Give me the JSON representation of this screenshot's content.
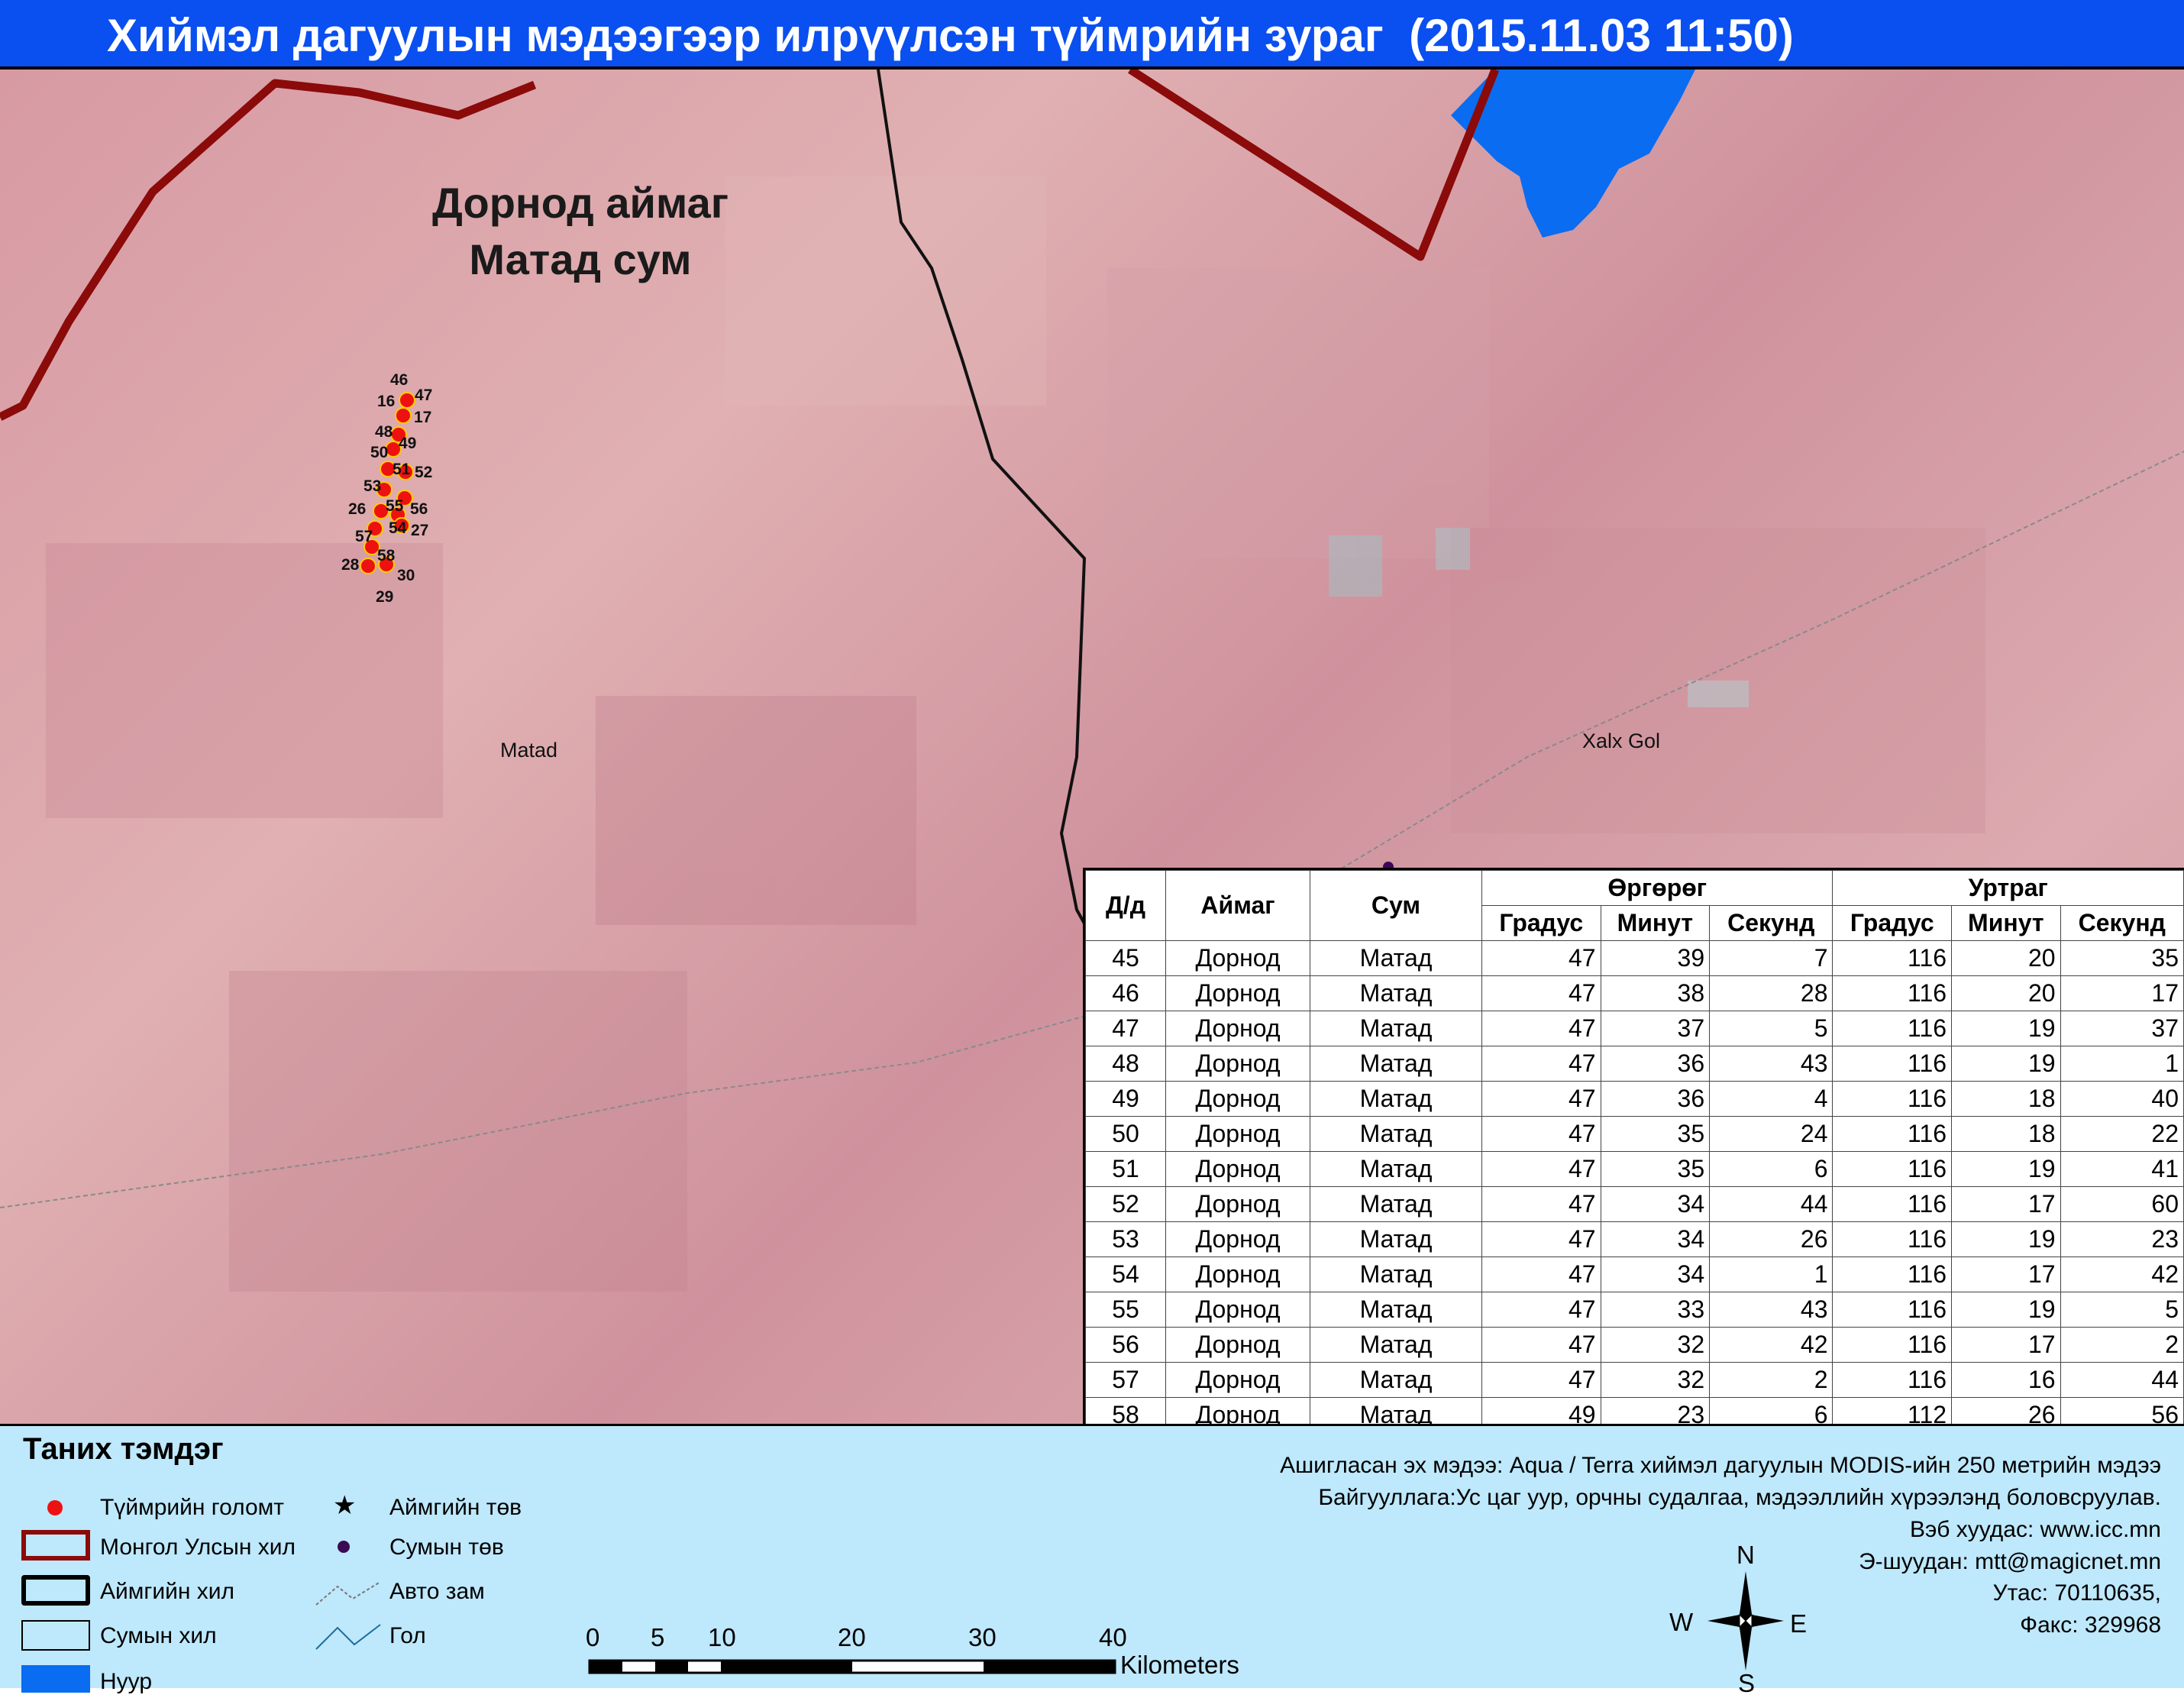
{
  "title": "Хиймэл дагуулын мэдээгээр илрүүлсэн түймрийн зураг  (2015.11.03 11:50)",
  "map": {
    "region_line1": "Дорнод  аймаг",
    "region_line2": "Матад  сум",
    "place_matad": "Matad",
    "place_xalx": "Xalx Gol",
    "fire_labels": [
      "46",
      "47",
      "16",
      "17",
      "48",
      "49",
      "50",
      "51",
      "52",
      "53",
      "26",
      "55",
      "56",
      "57",
      "54",
      "27",
      "28",
      "58",
      "30",
      "29"
    ]
  },
  "table": {
    "headers": {
      "dd": "Д/д",
      "aimag": "Аймаг",
      "sum": "Сум",
      "latitude": "Өргөрөг",
      "longitude": "Уртраг",
      "degree": "Градус",
      "minute": "Минут",
      "second": "Секунд"
    },
    "rows": [
      {
        "dd": "45",
        "aimag": "Дорнод",
        "sum": "Матад",
        "lat_d": "47",
        "lat_m": "39",
        "lat_s": "7",
        "lon_d": "116",
        "lon_m": "20",
        "lon_s": "35"
      },
      {
        "dd": "46",
        "aimag": "Дорнод",
        "sum": "Матад",
        "lat_d": "47",
        "lat_m": "38",
        "lat_s": "28",
        "lon_d": "116",
        "lon_m": "20",
        "lon_s": "17"
      },
      {
        "dd": "47",
        "aimag": "Дорнод",
        "sum": "Матад",
        "lat_d": "47",
        "lat_m": "37",
        "lat_s": "5",
        "lon_d": "116",
        "lon_m": "19",
        "lon_s": "37"
      },
      {
        "dd": "48",
        "aimag": "Дорнод",
        "sum": "Матад",
        "lat_d": "47",
        "lat_m": "36",
        "lat_s": "43",
        "lon_d": "116",
        "lon_m": "19",
        "lon_s": "1"
      },
      {
        "dd": "49",
        "aimag": "Дорнод",
        "sum": "Матад",
        "lat_d": "47",
        "lat_m": "36",
        "lat_s": "4",
        "lon_d": "116",
        "lon_m": "18",
        "lon_s": "40"
      },
      {
        "dd": "50",
        "aimag": "Дорнод",
        "sum": "Матад",
        "lat_d": "47",
        "lat_m": "35",
        "lat_s": "24",
        "lon_d": "116",
        "lon_m": "18",
        "lon_s": "22"
      },
      {
        "dd": "51",
        "aimag": "Дорнод",
        "sum": "Матад",
        "lat_d": "47",
        "lat_m": "35",
        "lat_s": "6",
        "lon_d": "116",
        "lon_m": "19",
        "lon_s": "41"
      },
      {
        "dd": "52",
        "aimag": "Дорнод",
        "sum": "Матад",
        "lat_d": "47",
        "lat_m": "34",
        "lat_s": "44",
        "lon_d": "116",
        "lon_m": "17",
        "lon_s": "60"
      },
      {
        "dd": "53",
        "aimag": "Дорнод",
        "sum": "Матад",
        "lat_d": "47",
        "lat_m": "34",
        "lat_s": "26",
        "lon_d": "116",
        "lon_m": "19",
        "lon_s": "23"
      },
      {
        "dd": "54",
        "aimag": "Дорнод",
        "sum": "Матад",
        "lat_d": "47",
        "lat_m": "34",
        "lat_s": "1",
        "lon_d": "116",
        "lon_m": "17",
        "lon_s": "42"
      },
      {
        "dd": "55",
        "aimag": "Дорнод",
        "sum": "Матад",
        "lat_d": "47",
        "lat_m": "33",
        "lat_s": "43",
        "lon_d": "116",
        "lon_m": "19",
        "lon_s": "5"
      },
      {
        "dd": "56",
        "aimag": "Дорнод",
        "sum": "Матад",
        "lat_d": "47",
        "lat_m": "32",
        "lat_s": "42",
        "lon_d": "116",
        "lon_m": "17",
        "lon_s": "2"
      },
      {
        "dd": "57",
        "aimag": "Дорнод",
        "sum": "Матад",
        "lat_d": "47",
        "lat_m": "32",
        "lat_s": "2",
        "lon_d": "116",
        "lon_m": "16",
        "lon_s": "44"
      },
      {
        "dd": "58",
        "aimag": "Дорнод",
        "sum": "Матад",
        "lat_d": "49",
        "lat_m": "23",
        "lat_s": "6",
        "lon_d": "112",
        "lon_m": "26",
        "lon_s": "56"
      }
    ]
  },
  "legend": {
    "title": "Таних тэмдэг",
    "items": {
      "fire": "Түймрийн голомт",
      "country_border": "Монгол Улсын хил",
      "aimag_border": "Аймгийн хил",
      "sum_border": "Сумын хил",
      "lake": "Нуур",
      "aimag_center": "Аймгийн төв",
      "sum_center": "Сумын төв",
      "road": "Авто зам",
      "river": "Гол"
    },
    "scale": {
      "ticks": [
        "0",
        "5",
        "10",
        "20",
        "30",
        "40"
      ],
      "unit": "Kilometers"
    },
    "compass": {
      "n": "N",
      "s": "S",
      "e": "E",
      "w": "W"
    },
    "info": {
      "source": "Ашигласан эх мэдээ: Aqua / Terra хиймэл дагуулын MODIS-ийн 250 метрийн мэдээ",
      "organization": "Байгууллага:Ус цаг уур, орчны судалгаа, мэдээллийн хүрээлэнд боловсруулав.",
      "website": "Вэб хуудас: www.icc.mn",
      "email": "Э-шуудан: mtt@magicnet.mn",
      "phone": "Утас: 70110635,",
      "fax": "Факс: 329968"
    }
  },
  "colors": {
    "title_bg": "#0a4ff0",
    "legend_bg": "#bee8fb",
    "country_border": "#8b0a0a",
    "fire": "#ee1111",
    "lake": "#0a6cf0"
  }
}
